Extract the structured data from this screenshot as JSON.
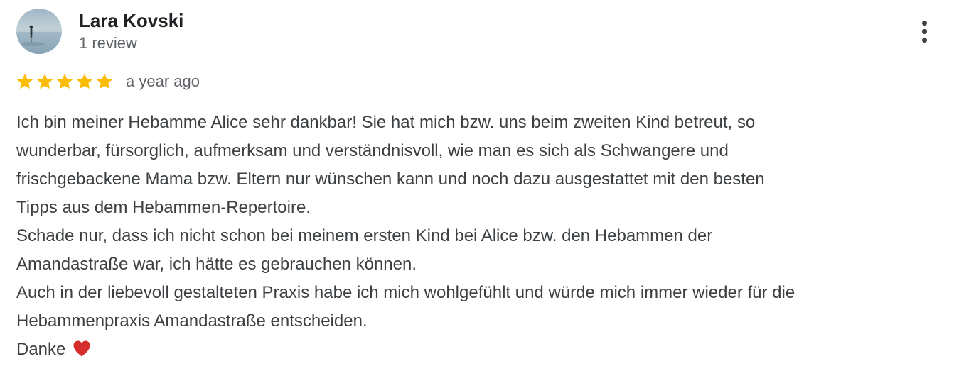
{
  "review": {
    "author": {
      "name": "Lara Kovski",
      "review_count": "1 review",
      "avatar_icon": "profile-photo-beach-silhouette"
    },
    "more_icon": "more-vertical-icon",
    "rating": {
      "stars": 5,
      "max_stars": 5,
      "star_color": "#FBBC04",
      "icon": "star-icon"
    },
    "date": "a year ago",
    "text_lines": [
      "Ich bin meiner Hebamme Alice sehr dankbar! Sie hat mich bzw. uns beim zweiten Kind betreut, so",
      "wunderbar, fürsorglich, aufmerksam und verständnisvoll, wie man es sich als Schwangere und",
      "frischgebackene Mama bzw. Eltern nur wünschen kann und noch dazu ausgestattet mit den besten",
      "Tipps aus dem Hebammen-Repertoire.",
      "Schade nur, dass ich nicht schon bei meinem ersten Kind bei Alice bzw. den Hebammen der",
      "Amandastraße war, ich hätte es gebrauchen können.",
      "Auch in der liebevoll gestalteten Praxis habe ich mich wohlgefühlt und würde mich immer wieder für die",
      "Hebammenpraxis Amandastraße entscheiden.",
      "Danke"
    ],
    "closing_emoji": "red-heart-icon",
    "heart_color": "#D62D2D"
  }
}
